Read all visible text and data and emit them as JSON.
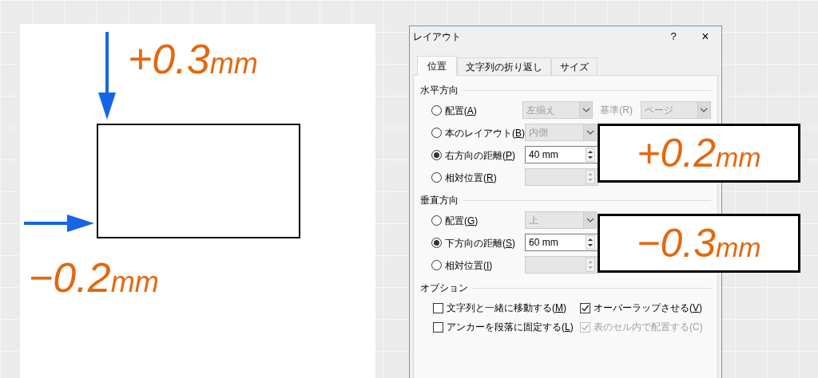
{
  "diagram": {
    "top_offset": {
      "value": "+0.3",
      "unit": "mm"
    },
    "left_offset": {
      "value": "−0.2",
      "unit": "mm"
    }
  },
  "dialog": {
    "title": "レイアウト",
    "help": "?",
    "close": "×",
    "tabs": [
      {
        "label": "位置",
        "selected": true
      },
      {
        "label": "文字列の折り返し",
        "selected": false
      },
      {
        "label": "サイズ",
        "selected": false
      }
    ],
    "sections": [
      {
        "title": "水平方向",
        "rows": [
          {
            "label": "配置(",
            "key": "A",
            "tail": ")",
            "selected": false,
            "control": {
              "kind": "dropdown",
              "value": "左揃え",
              "disabled": true
            },
            "extra": {
              "label": "基準(R)",
              "value": "ページ"
            }
          },
          {
            "label": "本のレイアウト(",
            "key": "B",
            "tail": ")",
            "selected": false,
            "control": {
              "kind": "dropdown",
              "value": "内側",
              "disabled": true
            }
          },
          {
            "label": "右方向の距離(",
            "key": "P",
            "tail": ")",
            "selected": true,
            "control": {
              "kind": "spin",
              "value": "40 mm",
              "disabled": false
            }
          },
          {
            "label": "相対位置(",
            "key": "R",
            "tail": ")",
            "selected": false,
            "control": {
              "kind": "spin",
              "disabled": true
            }
          }
        ]
      },
      {
        "title": "垂直方向",
        "rows": [
          {
            "label": "配置(",
            "key": "G",
            "tail": ")",
            "selected": false,
            "control": {
              "kind": "dropdown",
              "value": "上",
              "disabled": true
            }
          },
          {
            "label": "下方向の距離(",
            "key": "S",
            "tail": ")",
            "selected": true,
            "control": {
              "kind": "spin",
              "value": "60 mm",
              "disabled": false
            }
          },
          {
            "label": "相対位置(",
            "key": "I",
            "tail": ")",
            "selected": false,
            "control": {
              "kind": "spin",
              "disabled": true
            }
          }
        ]
      }
    ],
    "options": {
      "title": "オプション",
      "items": [
        {
          "label": "文字列と一緒に移動する(",
          "key": "M",
          "tail": ")",
          "checked": false,
          "disabled": false
        },
        {
          "label": "オーバーラップさせる(",
          "key": "V",
          "tail": ")",
          "checked": true,
          "disabled": false
        },
        {
          "label": "アンカーを段落に固定する(",
          "key": "L",
          "tail": ")",
          "checked": false,
          "disabled": false
        },
        {
          "label": "表のセル内で配置する(C)",
          "checked": true,
          "disabled": true
        }
      ]
    }
  },
  "callouts": [
    {
      "value": "+0.2",
      "unit": "mm"
    },
    {
      "value": "−0.3",
      "unit": "mm"
    }
  ]
}
